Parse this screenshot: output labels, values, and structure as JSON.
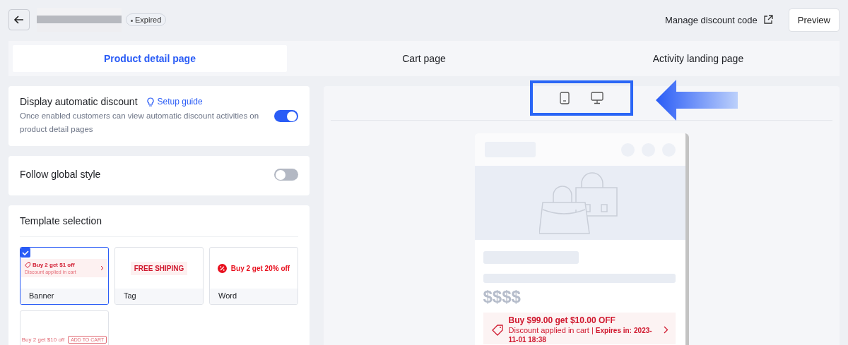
{
  "header": {
    "status": "Expired",
    "manage_link": "Manage discount code",
    "preview_button": "Preview"
  },
  "tabs": [
    {
      "label": "Product detail page",
      "selected": true
    },
    {
      "label": "Cart page",
      "selected": false
    },
    {
      "label": "Activity landing page",
      "selected": false
    }
  ],
  "settings": [
    {
      "title": "Display automatic discount",
      "link": "Setup guide",
      "description": "Once enabled customers can view automatic discount activities on product detail pages",
      "on": true
    },
    {
      "title": "Follow global style",
      "on": false
    }
  ],
  "template_selection": {
    "title": "Template selection",
    "templates": [
      {
        "kind": "banner",
        "label": "Banner",
        "selected": true,
        "preview_text": "Buy 2 get $1 off",
        "preview_subtext": "Discount applied in cart"
      },
      {
        "kind": "tag",
        "label": "Tag",
        "selected": false,
        "preview_text": "FREE SHIPING"
      },
      {
        "kind": "word",
        "label": "Word",
        "selected": false,
        "preview_text": "Buy 2 get 20% off"
      },
      {
        "kind": "button",
        "selected": false,
        "preview_text": "Buy 2 get $10 off",
        "button_text": "ADD TO CART"
      }
    ]
  },
  "preview": {
    "price": "$$$$",
    "offer_title": "Buy $99.00 get $10.00 OFF",
    "offer_note": "Discount applied in cart",
    "offer_separator": "|",
    "offer_expiry_label": "Expires in:",
    "offer_expiry": "2023-11-01 18:38"
  }
}
